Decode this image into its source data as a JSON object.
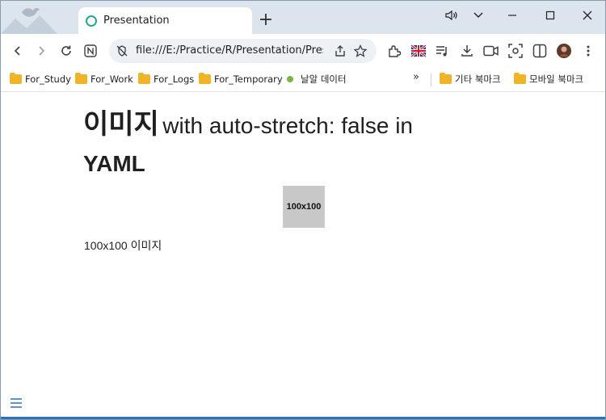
{
  "tab": {
    "title": "Presentation",
    "new_tab_icon": "plus-icon"
  },
  "window_controls": {
    "speaker_icon": "speaker-icon",
    "dropdown_icon": "chevron-down-icon",
    "minimize_icon": "minimize-icon",
    "maximize_icon": "maximize-icon",
    "close_icon": "close-icon"
  },
  "toolbar": {
    "url": "file:///E:/Practice/R/Presentation/Presentation.html",
    "icons": [
      "back-icon",
      "forward-icon",
      "reload-icon",
      "naver-icon",
      "not-secure-icon",
      "share-icon",
      "bookmark-star-icon",
      "extensions-icon",
      "flag-icon",
      "playlist-icon",
      "download-icon",
      "video-icon",
      "screenshot-icon",
      "split-view-icon",
      "profile-avatar",
      "more-menu-icon"
    ]
  },
  "bookmarks": {
    "items": [
      {
        "label": "For_Study",
        "icon": "folder-icon"
      },
      {
        "label": "For_Work",
        "icon": "folder-icon"
      },
      {
        "label": "For_Logs",
        "icon": "folder-icon"
      },
      {
        "label": "For_Temporary",
        "icon": "folder-icon"
      },
      {
        "label": "날알 데이터",
        "icon": "green-dot-icon"
      }
    ],
    "more": "»",
    "right_items": [
      {
        "label": "기타 북마크",
        "icon": "folder-icon"
      },
      {
        "label": "모바일 북마크",
        "icon": "folder-icon"
      }
    ]
  },
  "slide": {
    "heading_ko": "이미지",
    "heading_en": "with auto-stretch: false in",
    "heading_en2": "YAML",
    "image_label": "100x100",
    "caption": "100x100 이미지",
    "menu_icon": "hamburger-menu-icon"
  },
  "colors": {
    "tab_strip": "#dce4ee",
    "omnibox": "#edf1f6",
    "folder": "#f0b429",
    "accent_bottom": "#2f6fbf",
    "menu_icon": "#2f6fbf"
  }
}
